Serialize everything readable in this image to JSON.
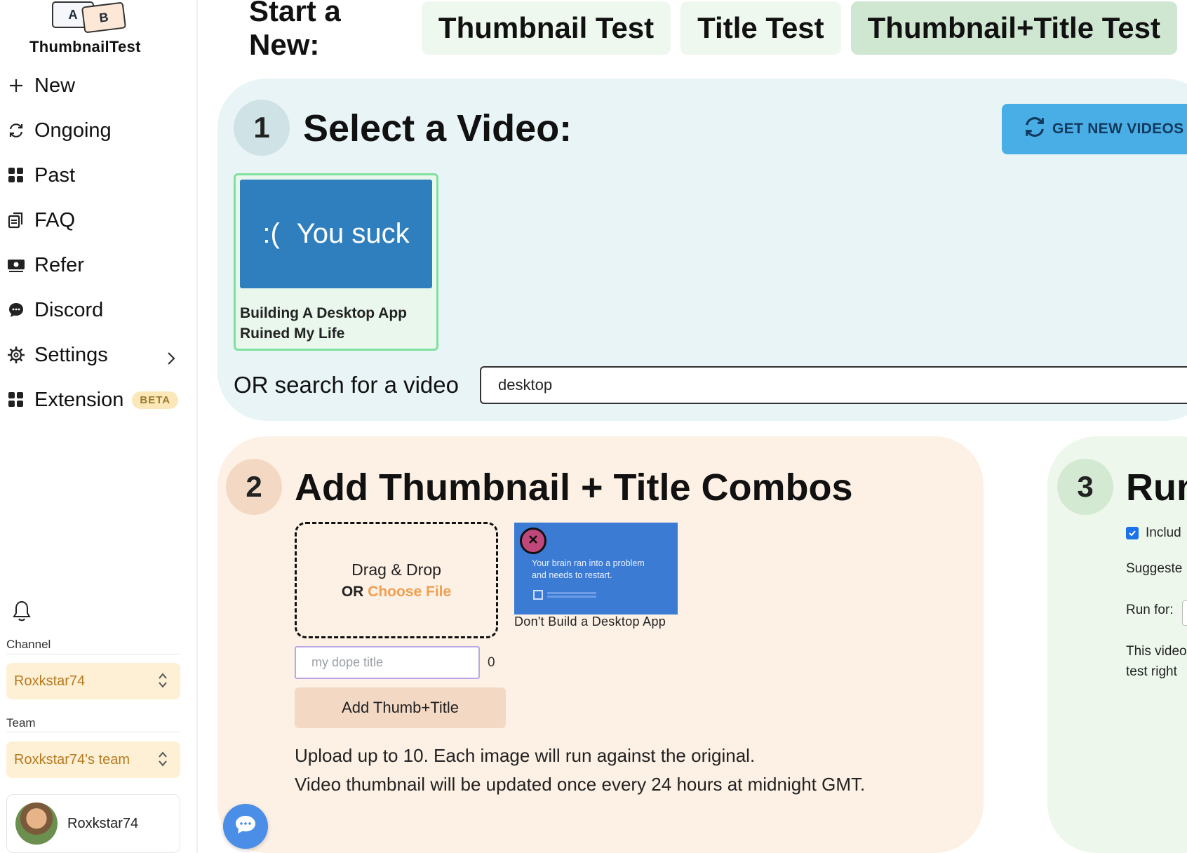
{
  "logo": {
    "card_a": "A",
    "card_b": "B",
    "text": "ThumbnailTest"
  },
  "sidebar": {
    "items": [
      {
        "label": "New",
        "icon": "plus-icon"
      },
      {
        "label": "Ongoing",
        "icon": "refresh-icon"
      },
      {
        "label": "Past",
        "icon": "grid-icon"
      },
      {
        "label": "FAQ",
        "icon": "document-icon"
      },
      {
        "label": "Refer",
        "icon": "money-icon"
      },
      {
        "label": "Discord",
        "icon": "chat-bubble-icon"
      },
      {
        "label": "Settings",
        "icon": "gear-icon"
      },
      {
        "label": "Extension",
        "icon": "grid-icon",
        "badge": "BETA"
      }
    ],
    "channel_label": "Channel",
    "channel_value": "Roxkstar74",
    "team_label": "Team",
    "team_value": "Roxkstar74's team",
    "user_name": "Roxkstar74"
  },
  "topbar": {
    "lead": "Start a New:",
    "tabs": [
      "Thumbnail Test",
      "Title Test",
      "Thumbnail+Title Test"
    ],
    "active_tab": "Thumbnail+Title Test"
  },
  "step1": {
    "number": "1",
    "title": "Select a Video:",
    "get_new_videos": "GET NEW VIDEOS",
    "video": {
      "thumb_face": ":(",
      "thumb_text": "You suck",
      "title": "Building A Desktop App Ruined My Life"
    },
    "search_label": "OR search for a video",
    "search_value": "desktop"
  },
  "step2": {
    "number": "2",
    "title": "Add Thumbnail + Title Combos",
    "drop_line1": "Drag & Drop",
    "drop_or": "OR",
    "drop_choose": "Choose File",
    "combo": {
      "thumb_text_1": "Your brain ran into a problem",
      "thumb_text_2": "and needs to restart.",
      "caption": "Don't Build a Desktop App"
    },
    "title_placeholder": "my dope title",
    "char_count": "0",
    "add_button": "Add Thumb+Title",
    "note_1": "Upload up to 10. Each image will run against the original.",
    "note_2": "Video thumbnail will be updated once every 24 hours at midnight GMT."
  },
  "step3": {
    "number": "3",
    "title": "Run",
    "include_label": "Includ",
    "suggested_label": "Suggeste",
    "run_for_label": "Run for:",
    "desc_1": "This video",
    "desc_2": "test right"
  },
  "colors": {
    "panel1_bg": "#e8f4f6",
    "panel2_bg": "#fdf0e4",
    "panel3_bg": "#edf7ec",
    "accent_blue": "#4aaee6",
    "select_bg": "#fdf0d5",
    "select_text": "#b7791f"
  }
}
